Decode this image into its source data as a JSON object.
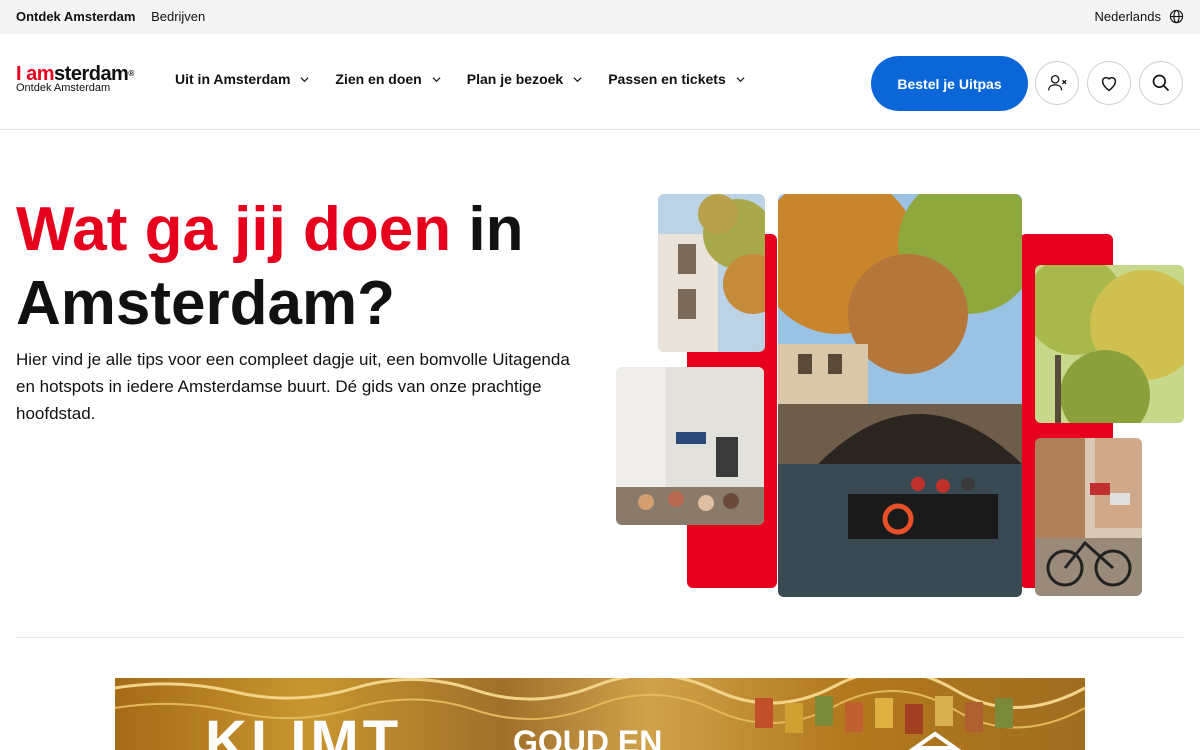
{
  "topbar": {
    "left_links": [
      "Ontdek Amsterdam",
      "Bedrijven"
    ],
    "language": "Nederlands"
  },
  "header": {
    "logo_i": "I",
    "logo_am": "am",
    "logo_rest": "sterdam",
    "logo_sub": "Ontdek Amsterdam",
    "nav": [
      "Uit in Amsterdam",
      "Zien en doen",
      "Plan je bezoek",
      "Passen en tickets"
    ],
    "cta": "Bestel je Uitpas",
    "icons": [
      "user-icon",
      "heart-icon",
      "search-icon"
    ]
  },
  "hero": {
    "title_red": "Wat ga jij doen",
    "title_black": "in Amsterdam?",
    "text": "Hier vind je alle tips voor een compleet dagje uit, een bomvolle Uitagenda en hotspots in iedere Amsterdamse buurt. Dé gids van onze prachtige hoofdstad."
  },
  "banner": {
    "title": "KLIMT",
    "subtitle": "GOUD EN"
  },
  "colors": {
    "brand_red": "#e6001e",
    "cta_blue": "#0b67d8"
  }
}
